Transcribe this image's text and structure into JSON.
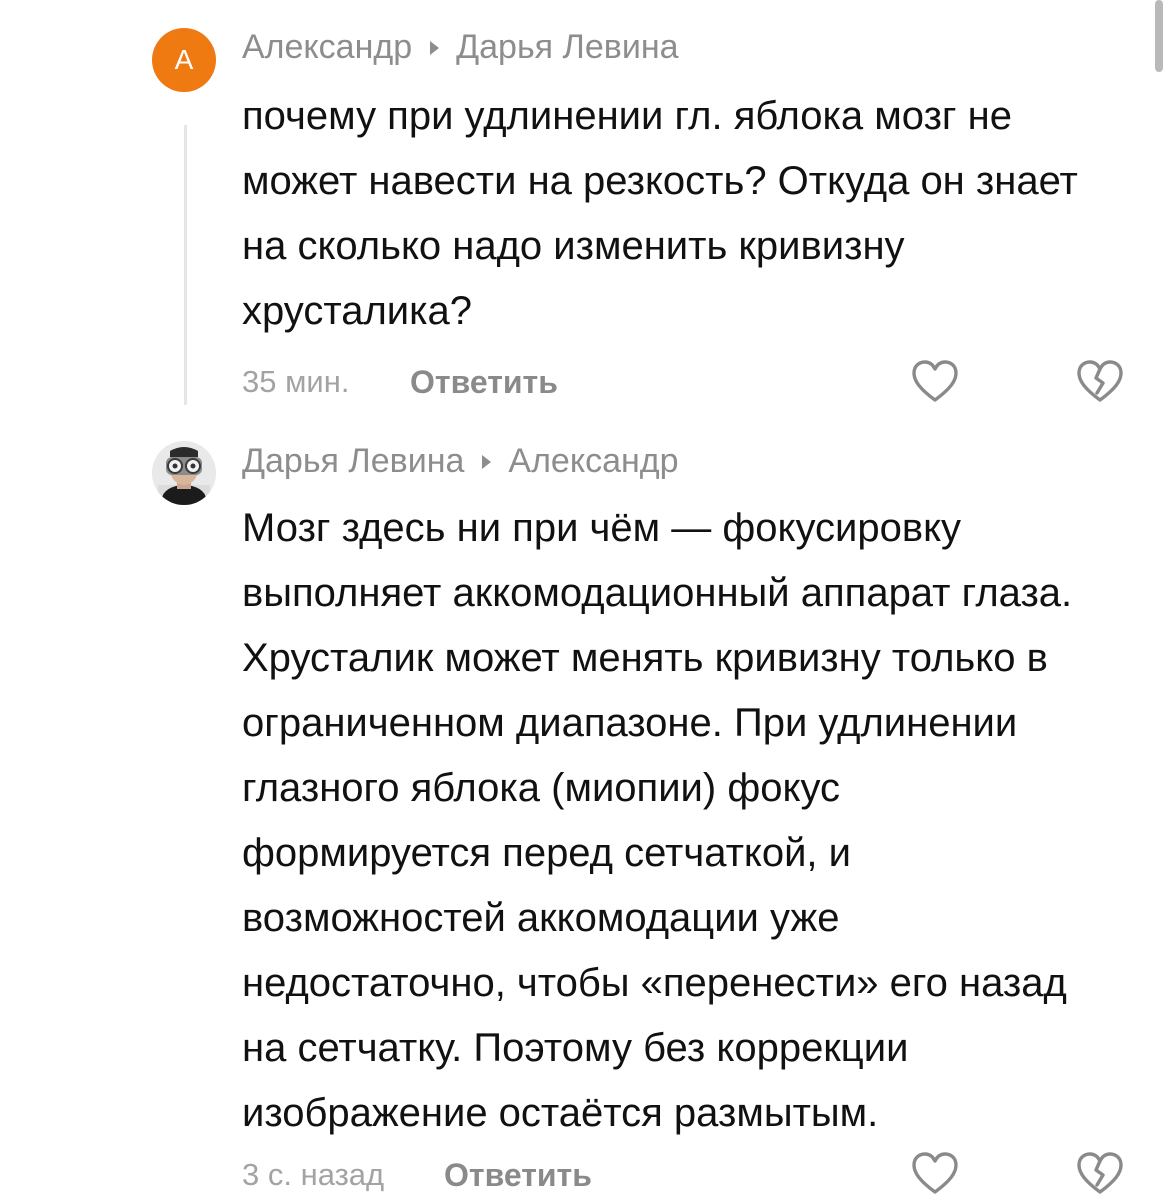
{
  "comments": [
    {
      "author": "Александр",
      "reply_to": "Дарья Левина",
      "avatar_letter": "А",
      "avatar_color": "#ef7a12",
      "lines": [
        "почему при удлинении гл. яблока мозг не",
        "может навести на резкость? Откуда он знает",
        "на сколько надо изменить кривизну",
        "хрусталика?"
      ],
      "time": "35 мин.",
      "reply_label": "Ответить",
      "like_icon": "heart-icon",
      "dislike_icon": "broken-heart-icon"
    },
    {
      "author": "Дарья Левина",
      "reply_to": "Александр",
      "lines": [
        "Мозг здесь ни при чём — фокусировку",
        "выполняет аккомодационный аппарат глаза.",
        "Хрусталик может менять кривизну только в",
        "ограниченном диапазоне. При удлинении",
        "глазного яблока (миопии) фокус",
        "формируется перед сетчаткой, и",
        "возможностей аккомодации уже",
        "недостаточно, чтобы «перенести» его назад",
        "на сетчатку. Поэтому без коррекции",
        "изображение остаётся размытым."
      ],
      "time": "3 с. назад",
      "reply_label": "Ответить",
      "like_icon": "heart-icon",
      "dislike_icon": "broken-heart-icon"
    }
  ]
}
